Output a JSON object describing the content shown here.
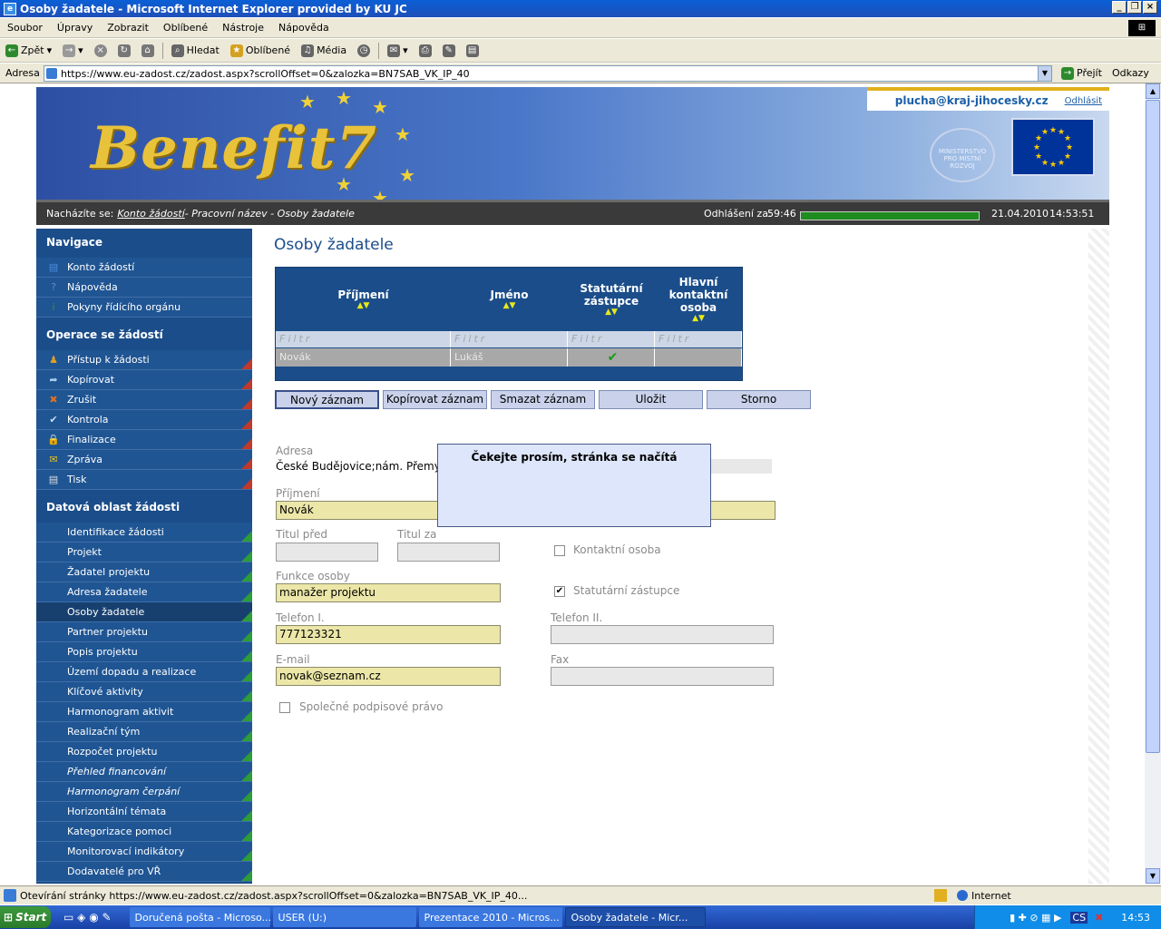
{
  "window": {
    "title": "Osoby žadatele - Microsoft Internet Explorer provided by KU JC"
  },
  "menu": [
    "Soubor",
    "Úpravy",
    "Zobrazit",
    "Oblíbené",
    "Nástroje",
    "Nápověda"
  ],
  "toolbar": {
    "back": "Zpět",
    "search": "Hledat",
    "favorites": "Oblíbené",
    "media": "Média"
  },
  "address": {
    "label": "Adresa",
    "url": "https://www.eu-zadost.cz/zadost.aspx?scrollOffset=0&zalozka=BN7SAB_VK_IP_40",
    "go": "Přejít",
    "links": "Odkazy"
  },
  "header": {
    "logo": "Benefit7",
    "user_email": "plucha@kraj-jihocesky.cz",
    "logout": "Odhlásit",
    "ministry": "MINISTERSTVO PRO MÍSTNÍ ROZVOJ"
  },
  "breadcrumb": {
    "prefix": "Nacházíte se:",
    "link": "Konto žádostí",
    "rest": " - Pracovní název - Osoby žadatele",
    "logout_in_label": "Odhlášení za:",
    "logout_in": "59:46",
    "date": "21.04.2010",
    "time": "14:53:51"
  },
  "sidebar": {
    "sections": [
      {
        "title": "Navigace",
        "items": [
          {
            "label": "Konto žádostí",
            "icon": "list-icon",
            "tri": ""
          },
          {
            "label": "Nápověda",
            "icon": "help-icon",
            "tri": ""
          },
          {
            "label": "Pokyny řídícího orgánu",
            "icon": "info-icon",
            "tri": ""
          }
        ]
      },
      {
        "title": "Operace se žádostí",
        "items": [
          {
            "label": "Přístup k žádosti",
            "icon": "users-icon",
            "tri": "red"
          },
          {
            "label": "Kopírovat",
            "icon": "copy-arrow-icon",
            "tri": "red"
          },
          {
            "label": "Zrušit",
            "icon": "cancel-icon",
            "tri": "red"
          },
          {
            "label": "Kontrola",
            "icon": "check-icon",
            "tri": "red"
          },
          {
            "label": "Finalizace",
            "icon": "lock-icon",
            "tri": "red"
          },
          {
            "label": "Zpráva",
            "icon": "message-icon",
            "tri": "red"
          },
          {
            "label": "Tisk",
            "icon": "print-icon",
            "tri": "red"
          }
        ]
      },
      {
        "title": "Datová oblast žádosti",
        "items": [
          {
            "label": "Identifikace žádosti",
            "tri": "green"
          },
          {
            "label": "Projekt",
            "tri": "green"
          },
          {
            "label": "Žadatel projektu",
            "tri": "green"
          },
          {
            "label": "Adresa žadatele",
            "tri": "green"
          },
          {
            "label": "Osoby žadatele",
            "tri": "green",
            "active": true
          },
          {
            "label": "Partner projektu",
            "tri": "green"
          },
          {
            "label": "Popis projektu",
            "tri": "green"
          },
          {
            "label": "Území dopadu a realizace",
            "tri": "green"
          },
          {
            "label": "Klíčové aktivity",
            "tri": "green"
          },
          {
            "label": "Harmonogram aktivit",
            "tri": "green"
          },
          {
            "label": "Realizační tým",
            "tri": "green"
          },
          {
            "label": "Rozpočet projektu",
            "tri": "green"
          },
          {
            "label": "Přehled financování",
            "tri": "green",
            "italic": true
          },
          {
            "label": "Harmonogram čerpání",
            "tri": "green",
            "italic": true
          },
          {
            "label": "Horizontální témata",
            "tri": "green"
          },
          {
            "label": "Kategorizace pomoci",
            "tri": "green"
          },
          {
            "label": "Monitorovací indikátory",
            "tri": "green"
          },
          {
            "label": "Dodavatelé pro VŘ",
            "tri": "green"
          }
        ]
      }
    ]
  },
  "page": {
    "title": "Osoby žadatele"
  },
  "grid": {
    "columns": [
      "Příjmení",
      "Jméno",
      "Statutární zástupce",
      "Hlavní kontaktní osoba"
    ],
    "filter": "Filtr",
    "rows": [
      {
        "prijmeni": "Novák",
        "jmeno": "Lukáš",
        "statutarni": "✔",
        "hlavni": ""
      }
    ]
  },
  "buttons": {
    "new": "Nový záznam",
    "copy": "Kopírovat záznam",
    "delete": "Smazat záznam",
    "save": "Uložit",
    "cancel": "Storno"
  },
  "form": {
    "adresa_label": "Adresa",
    "adresa_value": "České Budějovice;nám. Přemy",
    "prijmeni_label": "Příjmení",
    "prijmeni_value": "Novák",
    "titul_pred_label": "Titul před",
    "titul_pred_value": "",
    "titul_za_label": "Titul za",
    "titul_za_value": "",
    "kontaktni_label": "Kontaktní osoba",
    "kontaktni_checked": false,
    "funkce_label": "Funkce osoby",
    "funkce_value": "manažer projektu",
    "statutarni_label": "Statutární zástupce",
    "statutarni_checked": true,
    "telefon1_label": "Telefon I.",
    "telefon1_value": "777123321",
    "telefon2_label": "Telefon II.",
    "telefon2_value": "",
    "email_label": "E-mail",
    "email_value": "novak@seznam.cz",
    "fax_label": "Fax",
    "fax_value": "",
    "podpis_label": "Společné podpisové právo",
    "podpis_checked": false
  },
  "modal": {
    "text": "Čekejte prosím, stránka se načítá"
  },
  "status": {
    "text": "Otevírání stránky https://www.eu-zadost.cz/zadost.aspx?scrollOffset=0&zalozka=BN7SAB_VK_IP_40...",
    "zone": "Internet"
  },
  "taskbar": {
    "start": "Start",
    "items": [
      "Doručená pošta - Microso...",
      "USER (U:)",
      "Prezentace 2010 - Micros...",
      "Osoby žadatele - Micr..."
    ],
    "clock": "14:53",
    "lang": "CS"
  }
}
